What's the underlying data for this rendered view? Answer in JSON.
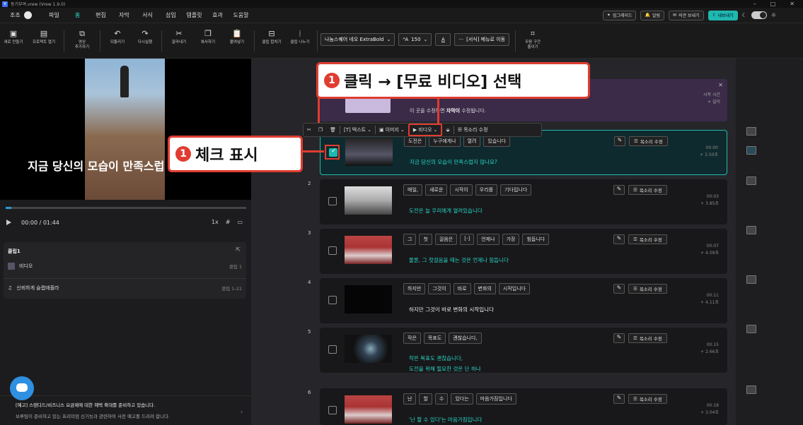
{
  "window": {
    "title": "동기부여.vrew (Vrew 1.9.0)"
  },
  "menubar": {
    "user": "조조",
    "items": [
      "파일",
      "홈",
      "편집",
      "자막",
      "서식",
      "삽입",
      "템플릿",
      "효과",
      "도움말"
    ],
    "active_index": 1,
    "right": {
      "upgrade": "업그레이드",
      "alerts": "알림",
      "feedback": "의견 보내기",
      "export": "내보내기"
    }
  },
  "toolbar": {
    "items": [
      {
        "label": "새로 만들기",
        "icon": "new-project-icon"
      },
      {
        "label": "프로젝트 열기",
        "icon": "folder-icon"
      },
      {
        "label": "영상\n추가하기",
        "icon": "add-video-icon"
      },
      {
        "label": "되돌리기",
        "icon": "undo-icon"
      },
      {
        "label": "다시실행",
        "icon": "redo-icon"
      },
      {
        "label": "잘라내기",
        "icon": "scissors-icon"
      },
      {
        "label": "복사하기",
        "icon": "copy-icon"
      },
      {
        "label": "붙여넣기",
        "icon": "paste-icon"
      },
      {
        "label": "클립 합치기",
        "icon": "merge-icon"
      },
      {
        "label": "클립 나누기",
        "icon": "split-icon"
      }
    ],
    "font": "나눔스퀘어 네오 ExtraBold",
    "font_size": "150",
    "format_move": "[서식] 메뉴로 이동",
    "silence": "무음 구간\n줄이기"
  },
  "preview": {
    "caption": "지금 당신의 모습이 만족스럽"
  },
  "player": {
    "time": "00:00  / 01:44",
    "speed": "1x"
  },
  "clip_panel": {
    "title": "클립1",
    "rows": [
      {
        "label": "비디오",
        "right": "클립 1"
      },
      {
        "label": "신뢰하게 슬랩애플라",
        "right": "클립 1-21"
      }
    ]
  },
  "notice": {
    "title": "[예고] 스탠다드/비즈니스 요금제에 대한 혜택 확대를 준비하고 있습니다.",
    "body": "브루팀이 준비하고 있는 프리미엄 신기능과 관련하여 사전 예고를 드리려 합니다."
  },
  "banner": {
    "text_pre": "이 곳을 수정하면 ",
    "text_bold": "자막이",
    "text_post": " 수정됩니다.",
    "right1": "시작 시간",
    "right2": "+ 길이"
  },
  "floatbar": {
    "text": "텍스트",
    "image": "이미지",
    "video": "비디오",
    "voice": "목소리 수정"
  },
  "callouts": {
    "c1": "클릭 → [무료 비디오] 선택",
    "c2": "체크 표시",
    "num": "1"
  },
  "clips": [
    {
      "num": "1",
      "words": [
        "도전은",
        "누구에게나",
        "열려",
        "있습니다"
      ],
      "sentence": [
        "지금 당신의 모습이 만족스럽지 않나요?"
      ],
      "time": "00:00",
      "dur": "+ 3.50초",
      "checked": true
    },
    {
      "num": "2",
      "words": [
        "매일,",
        "새로운",
        "시작이",
        "우리를",
        "기다립니다"
      ],
      "sentence": [
        "도전은 늘 우리에게 열려있습니다"
      ],
      "time": "00:03",
      "dur": "+ 3.85초",
      "checked": false
    },
    {
      "num": "3",
      "words": [
        "그",
        "첫",
        "걸음은",
        "[-]",
        "언제나",
        "가장",
        "힘듭니다"
      ],
      "sentence": [
        "물론, 그 첫걸음을 떼는 것은 언제나 힘듭니다"
      ],
      "time": "00:07",
      "dur": "+ 4.09초",
      "checked": false
    },
    {
      "num": "4",
      "words": [
        "하지만",
        "그것이",
        "바로",
        "변화의",
        "시작입니다"
      ],
      "sentence": [
        "하지만 그것이 바로 변화의 시작입니다"
      ],
      "time": "00:11",
      "dur": "+ 4.11초",
      "checked": false,
      "white": true
    },
    {
      "num": "5",
      "words": [
        "작은",
        "목표도",
        "괜찮습니다,"
      ],
      "sentence": [
        "작은 목표도 괜찮습니다,",
        "도전을 위해 필요한 것은 단 하나"
      ],
      "time": "00:15",
      "dur": "+ 2.66초",
      "checked": false
    },
    {
      "num": "6",
      "words": [
        "난",
        "할",
        "수",
        "있다는",
        "마음가짐입니다"
      ],
      "sentence": [
        "'난 할 수 있다'는 마음가짐입니다"
      ],
      "time": "00:18",
      "dur": "+ 3.04초",
      "checked": false
    }
  ],
  "clip_voice_label": "목소리 수정"
}
